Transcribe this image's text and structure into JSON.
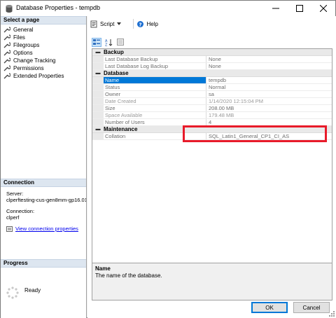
{
  "window": {
    "title": "Database Properties - tempdb"
  },
  "left": {
    "select_page_header": "Select a page",
    "pages": [
      {
        "label": "General",
        "icon": "wrench-icon"
      },
      {
        "label": "Files",
        "icon": "wrench-icon"
      },
      {
        "label": "Filegroups",
        "icon": "wrench-icon"
      },
      {
        "label": "Options",
        "icon": "wrench-icon"
      },
      {
        "label": "Change Tracking",
        "icon": "wrench-icon"
      },
      {
        "label": "Permissions",
        "icon": "wrench-icon"
      },
      {
        "label": "Extended Properties",
        "icon": "wrench-icon"
      }
    ],
    "connection_header": "Connection",
    "server_label": "Server:",
    "server_value": "clperftesting-cus-gen8mm-gp16.01",
    "connection_label": "Connection:",
    "connection_value": "clperf",
    "view_link": "View connection properties",
    "progress_header": "Progress",
    "progress_status": "Ready"
  },
  "toolbar": {
    "script_label": "Script",
    "help_label": "Help"
  },
  "grid": {
    "categories": [
      {
        "name": "Backup",
        "rows": [
          {
            "name": "Last Database Backup",
            "value": "None"
          },
          {
            "name": "Last Database Log Backup",
            "value": "None"
          }
        ]
      },
      {
        "name": "Database",
        "rows": [
          {
            "name": "Name",
            "value": "tempdb"
          },
          {
            "name": "Status",
            "value": "Normal"
          },
          {
            "name": "Owner",
            "value": "sa"
          },
          {
            "name": "Date Created",
            "value": "1/14/2020 12:15:04 PM"
          },
          {
            "name": "Size",
            "value": "208.00 MB"
          },
          {
            "name": "Space Available",
            "value": "179.48 MB"
          },
          {
            "name": "Number of Users",
            "value": "4"
          }
        ]
      },
      {
        "name": "Maintenance",
        "rows": [
          {
            "name": "Collation",
            "value": "SQL_Latin1_General_CP1_CI_AS"
          }
        ]
      }
    ]
  },
  "description": {
    "title": "Name",
    "text": "The name of the database."
  },
  "buttons": {
    "ok": "OK",
    "cancel": "Cancel"
  },
  "colors": {
    "highlight": "#e81b2a",
    "selection": "#0078d7",
    "link": "#0000ee"
  }
}
